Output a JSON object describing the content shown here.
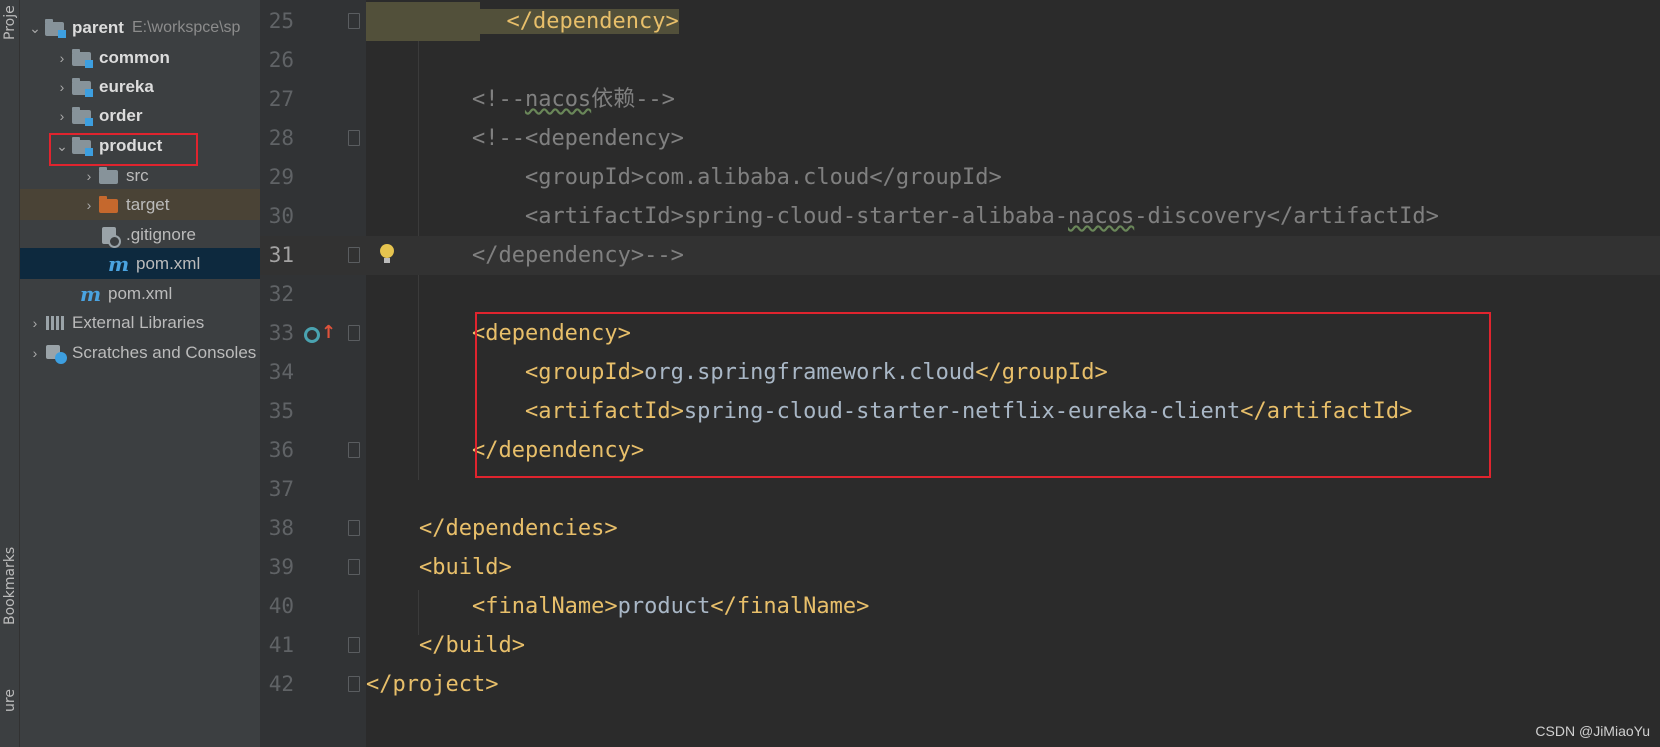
{
  "sidebar_strip": {
    "project_tab": "Proje",
    "bookmarks_tab": "Bookmarks",
    "structure_tab": "ure"
  },
  "tree": {
    "root": {
      "label": "parent",
      "path": "E:\\workspce\\sp"
    },
    "items": [
      {
        "label": "common"
      },
      {
        "label": "eureka"
      },
      {
        "label": "order"
      },
      {
        "label": "product"
      },
      {
        "label": "src"
      },
      {
        "label": "target"
      },
      {
        "label": ".gitignore"
      },
      {
        "label": "pom.xml"
      },
      {
        "label": "pom.xml"
      },
      {
        "label": "External Libraries"
      },
      {
        "label": "Scratches and Consoles"
      }
    ],
    "maven_icon": "m"
  },
  "editor": {
    "line_numbers": [
      "25",
      "26",
      "27",
      "28",
      "29",
      "30",
      "31",
      "32",
      "33",
      "34",
      "35",
      "36",
      "37",
      "38",
      "39",
      "40",
      "41",
      "42"
    ],
    "current_line": "31",
    "lines": {
      "l25": "</dependency>",
      "l27a": "<!--",
      "l27b": "nacos",
      "l27c": "依赖-->",
      "l28": "<!--<dependency>",
      "l29": "<groupId>com.alibaba.cloud</groupId>",
      "l30a": "<artifactId>spring-cloud-starter-alibaba-",
      "l30b": "nacos",
      "l30c": "-discovery</artifactId>",
      "l31": "</dependency>-->",
      "l33": "<dependency>",
      "l34_open": "<groupId>",
      "l34_text": "org.springframework.cloud",
      "l34_close": "</groupId>",
      "l35_open": "<artifactId>",
      "l35_text": "spring-cloud-starter-netflix-eureka-client",
      "l35_close": "</artifactId>",
      "l36": "</dependency>",
      "l38": "</dependencies>",
      "l39": "<build>",
      "l40_open": "<finalName>",
      "l40_text": "product",
      "l40_close": "</finalName>",
      "l41": "</build>",
      "l42": "</project>"
    }
  },
  "watermark": "CSDN @JiMiaoYu",
  "colors": {
    "tag": "#e8bf6a",
    "comment": "#808080",
    "text": "#a9b7c6",
    "highlight_box": "#e0242e",
    "selection": "#0d293e"
  }
}
